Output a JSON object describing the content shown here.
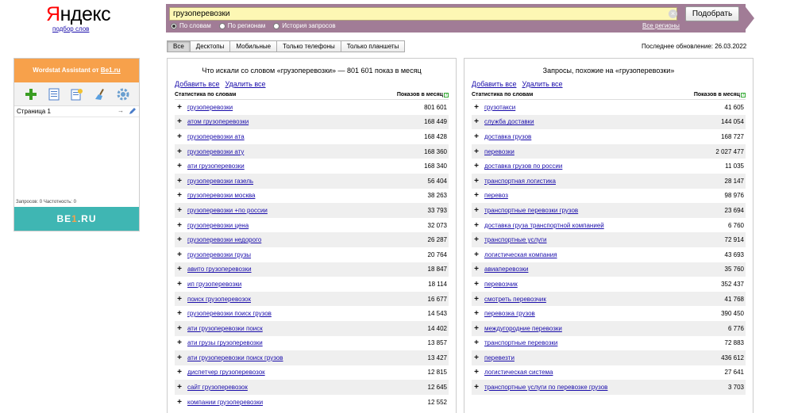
{
  "logo": {
    "ya": "Я",
    "rest": "ндекс",
    "sublink": "подбор слов"
  },
  "search": {
    "value": "грузоперевозки",
    "button": "Подобрать",
    "radios": [
      {
        "label": "По словам",
        "checked": true
      },
      {
        "label": "По регионам",
        "checked": false
      },
      {
        "label": "История запросов",
        "checked": false
      }
    ],
    "all_regions": "Все регионы"
  },
  "device_tabs": [
    "Все",
    "Десктопы",
    "Мобильные",
    "Только телефоны",
    "Только планшеты"
  ],
  "last_update": "Последнее обновление: 26.03.2022",
  "assistant": {
    "title_prefix": "Wordstat Assistant от ",
    "title_link": "Be1.ru",
    "page_label": "Страница 1",
    "stats": "Запросов: 0   Частотность: 0",
    "footer_pre": "BE",
    "footer_one": "1",
    "footer_post": ".RU"
  },
  "left_panel": {
    "title": "Что искали со словом «грузоперевозки» — 801 601 показ в месяц",
    "add_all": "Добавить все",
    "remove_all": "Удалить все",
    "col_kw": "Статистика по словам",
    "col_cnt": "Показов в месяц",
    "rows": [
      {
        "kw": "грузоперевозки",
        "cnt": "801 601"
      },
      {
        "kw": "атом грузоперевозки",
        "cnt": "168 449"
      },
      {
        "kw": "грузоперевозки ата",
        "cnt": "168 428"
      },
      {
        "kw": "грузоперевозки ату",
        "cnt": "168 360"
      },
      {
        "kw": "ати грузоперевозки",
        "cnt": "168 340"
      },
      {
        "kw": "грузоперевозки газель",
        "cnt": "56 404"
      },
      {
        "kw": "грузоперевозки москва",
        "cnt": "38 263"
      },
      {
        "kw": "грузоперевозки +по россии",
        "cnt": "33 793"
      },
      {
        "kw": "грузоперевозки цена",
        "cnt": "32 073"
      },
      {
        "kw": "грузоперевозки недорого",
        "cnt": "26 287"
      },
      {
        "kw": "грузоперевозки грузы",
        "cnt": "20 764"
      },
      {
        "kw": "авито грузоперевозки",
        "cnt": "18 847"
      },
      {
        "kw": "ип грузоперевозки",
        "cnt": "18 114"
      },
      {
        "kw": "поиск грузоперевозок",
        "cnt": "16 677"
      },
      {
        "kw": "грузоперевозки поиск грузов",
        "cnt": "14 543"
      },
      {
        "kw": "ати грузоперевозки поиск",
        "cnt": "14 402"
      },
      {
        "kw": "ати грузы грузоперевозки",
        "cnt": "13 857"
      },
      {
        "kw": "ати грузоперевозки поиск грузов",
        "cnt": "13 427"
      },
      {
        "kw": "диспетчер грузоперевозок",
        "cnt": "12 815"
      },
      {
        "kw": "сайт грузоперевозок",
        "cnt": "12 645"
      },
      {
        "kw": "компании грузоперевозки",
        "cnt": "12 552"
      }
    ]
  },
  "right_panel": {
    "title": "Запросы, похожие на «грузоперевозки»",
    "add_all": "Добавить все",
    "remove_all": "Удалить все",
    "col_kw": "Статистика по словам",
    "col_cnt": "Показов в месяц",
    "rows": [
      {
        "kw": "грузотакси",
        "cnt": "41 605"
      },
      {
        "kw": "служба доставки",
        "cnt": "144 054"
      },
      {
        "kw": "доставка грузов",
        "cnt": "168 727"
      },
      {
        "kw": "перевозки",
        "cnt": "2 027 477"
      },
      {
        "kw": "доставка грузов по россии",
        "cnt": "11 035"
      },
      {
        "kw": "транспортная логистика",
        "cnt": "28 147"
      },
      {
        "kw": "перевоз",
        "cnt": "98 976"
      },
      {
        "kw": "транспортные перевозки грузов",
        "cnt": "23 694"
      },
      {
        "kw": "доставка груза транспортной компанией",
        "cnt": "6 760"
      },
      {
        "kw": "транспортные услуги",
        "cnt": "72 914"
      },
      {
        "kw": "логистическая компания",
        "cnt": "43 693"
      },
      {
        "kw": "авиаперевозки",
        "cnt": "35 760"
      },
      {
        "kw": "перевозчик",
        "cnt": "352 437"
      },
      {
        "kw": "смотреть перевозчик",
        "cnt": "41 768"
      },
      {
        "kw": "перевозка грузов",
        "cnt": "390 450"
      },
      {
        "kw": "междугородние перевозки",
        "cnt": "6 776"
      },
      {
        "kw": "транспортные перевозки",
        "cnt": "72 883"
      },
      {
        "kw": "перевезти",
        "cnt": "436 612"
      },
      {
        "kw": "логистическая система",
        "cnt": "27 641"
      },
      {
        "kw": "транспортные услуги по перевозке грузов",
        "cnt": "3 703"
      }
    ]
  }
}
